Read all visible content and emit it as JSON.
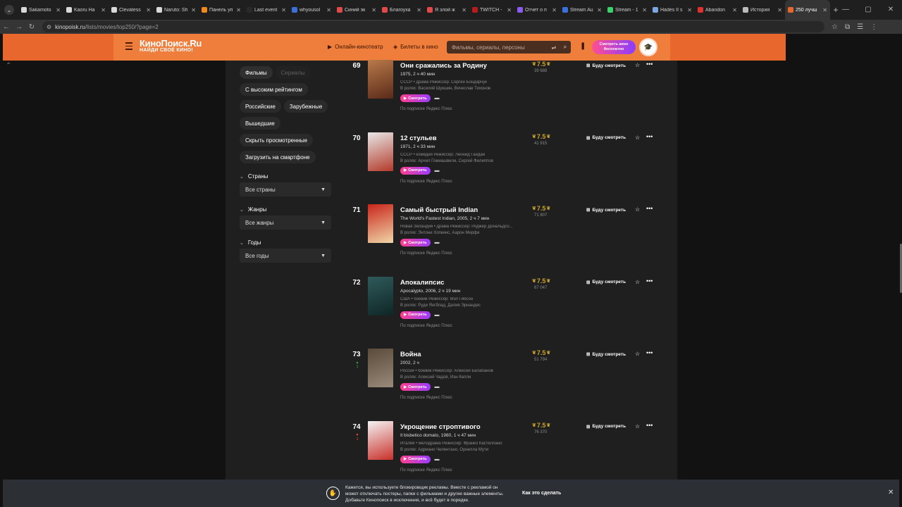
{
  "browser": {
    "tabs": [
      {
        "title": "Sakamoto",
        "color": "#d9d9d9"
      },
      {
        "title": "Kaoru Ha",
        "color": "#d9d9d9"
      },
      {
        "title": "Clevatess",
        "color": "#d9d9d9"
      },
      {
        "title": "Naruto: Sh",
        "color": "#d9d9d9"
      },
      {
        "title": "Панель уп",
        "color": "#f08a1c"
      },
      {
        "title": "Last event",
        "color": "#2a2a2a"
      },
      {
        "title": "whyousol",
        "color": "#3b6fd9"
      },
      {
        "title": "Синий эк",
        "color": "#e04a4a"
      },
      {
        "title": "Благоуха",
        "color": "#e04a4a"
      },
      {
        "title": "Я злой ж",
        "color": "#e04a4a"
      },
      {
        "title": "TWITCH -",
        "color": "#b51d1d"
      },
      {
        "title": "Отчет о п",
        "color": "#8a5cf0"
      },
      {
        "title": "Stream Au",
        "color": "#3b6fd9"
      },
      {
        "title": "Stream - 1",
        "color": "#3bd16b"
      },
      {
        "title": "Hades II s",
        "color": "#7aa7e0"
      },
      {
        "title": "Abandon",
        "color": "#e03030"
      },
      {
        "title": "История",
        "color": "#bbbbbb"
      },
      {
        "title": "250 лучш",
        "color": "#e8672d"
      }
    ],
    "url_host": "kinopoisk.ru",
    "url_path": "/lists/movies/top250/?page=2"
  },
  "header": {
    "logo_main": "КиноПоиск.Ru",
    "logo_tagline": "НАЙДИ СВОЁ КИНО!",
    "link_online": "Онлайн-кинотеатр",
    "link_tickets": "Билеты в кино",
    "search_placeholder": "Фильмы, сериалы, персоны",
    "promo_line1": "Смотреть кино",
    "promo_line2": "бесплатно"
  },
  "sidebar": {
    "tab_films": "Фильмы",
    "tab_series": "Сериалы",
    "chip_high_rating": "С высоким рейтингом",
    "chip_russian": "Российские",
    "chip_foreign": "Зарубежные",
    "chip_released": "Вышедшие",
    "chip_hide_watched": "Скрыть просмотренные",
    "chip_download": "Загрузить на смартфоне",
    "countries_title": "Страны",
    "countries_value": "Все страны",
    "genres_title": "Жанры",
    "genres_value": "Все жанры",
    "years_title": "Годы",
    "years_value": "Все годы"
  },
  "list_labels": {
    "watch": "Смотреть",
    "subscription": "По подписке Яндекс Плюс",
    "will_watch": "Буду смотреть"
  },
  "movies": [
    {
      "rank": "69",
      "title": "Они сражались за Родину",
      "sub": "1975, 2 ч 40 мин",
      "meta": "СССР • драма  Режиссёр: Сергей Бондарчук",
      "cast": "В ролях: Василий Шукшин, Вячеслав Тихонов",
      "rating": "7.5",
      "votes": "39 688",
      "trend": "",
      "trend_val": "",
      "poster_a": "#b97a4a",
      "poster_b": "#5a2a18"
    },
    {
      "rank": "70",
      "title": "12 стульев",
      "sub": "1971, 2 ч 33 мин",
      "meta": "СССР • комедия  Режиссёр: Леонид Гайдай",
      "cast": "В ролях: Арчил Гомиашвили, Сергей Филиппов",
      "rating": "7.5",
      "votes": "41 915",
      "trend": "",
      "trend_val": "",
      "poster_a": "#e8e8e8",
      "poster_b": "#b33a2a"
    },
    {
      "rank": "71",
      "title": "Самый быстрый Indian",
      "sub": "The World's Fastest Indian, 2005, 2 ч 7 мин",
      "meta": "Новая Зеландия • драма  Режиссёр: Роджер Дональдсо...",
      "cast": "В ролях: Энтони Хопкинс, Аарон Мерфи",
      "rating": "7.5",
      "votes": "71 807",
      "trend": "",
      "trend_val": "",
      "poster_a": "#c8251a",
      "poster_b": "#f0d6a8"
    },
    {
      "rank": "72",
      "title": "Апокалипсис",
      "sub": "Apocalypto, 2006, 2 ч 19 мин",
      "meta": "США • боевик  Режиссёр: Мэл Гибсон",
      "cast": "В ролях: Руди Янгблад, Далия Эрнандес",
      "rating": "7.5",
      "votes": "67 047",
      "trend": "",
      "trend_val": "",
      "poster_a": "#2f5a5a",
      "poster_b": "#0f2626"
    },
    {
      "rank": "73",
      "title": "Война",
      "sub": "2002, 2 ч",
      "meta": "Россия • боевик  Режиссёр: Алексей Балабанов",
      "cast": "В ролях: Алексей Чадов, Иэн Келли",
      "rating": "7.5",
      "votes": "51 794",
      "trend": "up",
      "trend_val": "1",
      "poster_a": "#5a4a3a",
      "poster_b": "#9a8a7a"
    },
    {
      "rank": "74",
      "title": "Укрощение строптивого",
      "sub": "Il bisbetico domato, 1980, 1 ч 47 мин",
      "meta": "Италия • мелодрама  Режиссёр: Франко Кастеллано",
      "cast": "В ролях: Адриано Челентано, Орнелла Мути",
      "rating": "7.5",
      "votes": "76 370",
      "trend": "down",
      "trend_val": "1",
      "poster_a": "#f4f4f4",
      "poster_b": "#c9302a"
    }
  ],
  "ad_banner": {
    "text": "Кажется, вы используете блокировщик рекламы. Вместе с рекламой он может отключать постеры, папки с фильмами и другие важные элементы. Добавьте Кинопоиск в исключения, и всё будет в порядке.",
    "link": "Как это сделать"
  }
}
